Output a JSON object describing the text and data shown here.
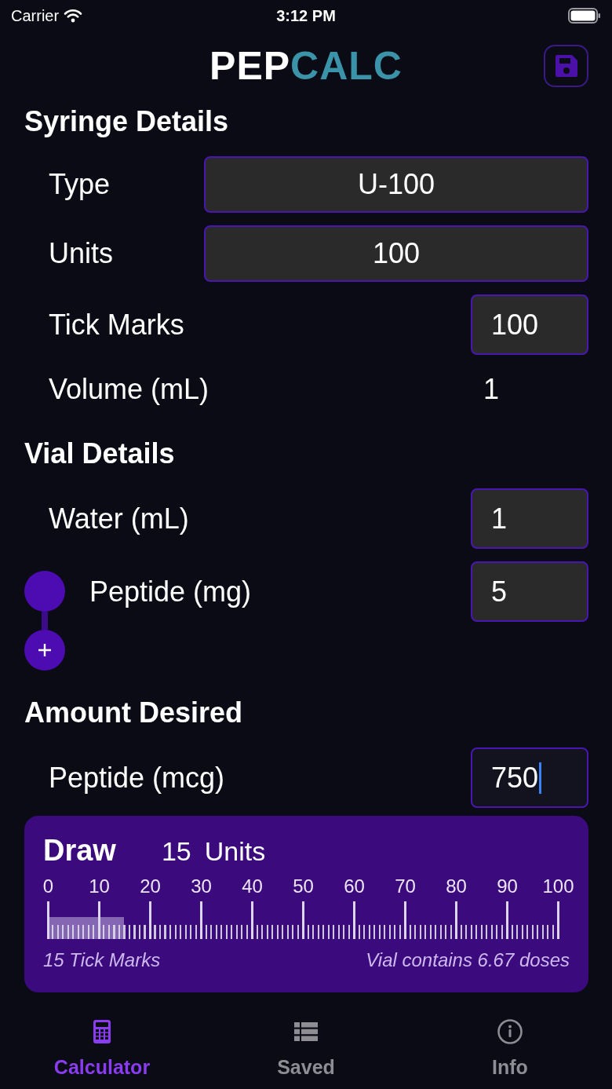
{
  "status_bar": {
    "carrier": "Carrier",
    "time": "3:12 PM"
  },
  "header": {
    "logo": {
      "primary": "PEP",
      "accent": "CALC"
    }
  },
  "sections": [
    {
      "title": "Syringe Details",
      "rows": [
        {
          "kind": "picker",
          "label": "Type",
          "value": "U-100",
          "focused": false
        },
        {
          "kind": "picker",
          "label": "Units",
          "value": "100",
          "focused": false
        },
        {
          "kind": "input",
          "label": "Tick Marks",
          "value": "100",
          "focused": false
        },
        {
          "kind": "readout",
          "label": "Volume (mL)",
          "value": "1",
          "focused": false
        }
      ]
    },
    {
      "title": "Vial Details",
      "rows": [
        {
          "kind": "input",
          "label": "Water (mL)",
          "value": "1",
          "focused": false
        },
        {
          "kind": "peptide",
          "label": "Peptide (mg)",
          "value": "5",
          "focused": false
        }
      ]
    },
    {
      "title": "Amount Desired",
      "rows": [
        {
          "kind": "input",
          "label": "Peptide (mcg)",
          "value": "750",
          "focused": true
        }
      ]
    }
  ],
  "draw": {
    "title": "Draw",
    "amount": "15",
    "unit": "Units",
    "scale_labels": [
      "0",
      "10",
      "20",
      "30",
      "40",
      "50",
      "60",
      "70",
      "80",
      "90",
      "100"
    ],
    "level": 0.15,
    "tick_marks": "15 Tick Marks",
    "doses": "Vial contains 6.67 doses"
  },
  "tabs": [
    {
      "label": "Calculator",
      "selected": true
    },
    {
      "label": "Saved",
      "selected": false
    },
    {
      "label": "Info",
      "selected": false
    }
  ]
}
